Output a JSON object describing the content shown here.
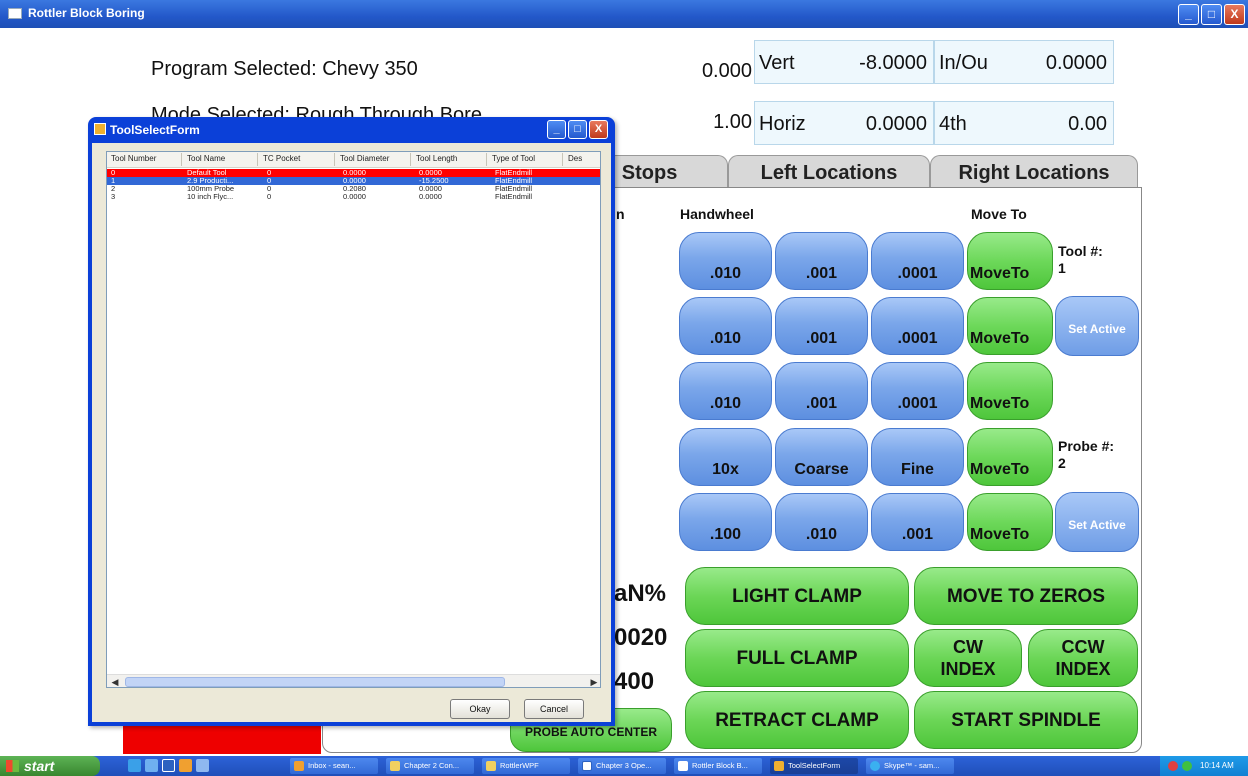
{
  "window": {
    "title": "Rottler Block Boring",
    "minimize": "_",
    "maximize": "□",
    "close": "X"
  },
  "header": {
    "program_label": "Program Selected: Chevy 350",
    "mode_label": "Mode Selected: Rough Through Bore",
    "readout_1": "0.000",
    "readout_2": "1.00",
    "vert_label": "Vert",
    "vert_value": "-8.0000",
    "inout_label": "In/Ou",
    "inout_value": "0.0000",
    "horiz_label": "Horiz",
    "horiz_value": "0.0000",
    "fourth_label": "4th",
    "fourth_value": "0.00"
  },
  "tabs": {
    "stops": "l Stops",
    "left": "Left Locations",
    "right": "Right Locations"
  },
  "panel": {
    "col_on": "n",
    "handwheel": "Handwheel",
    "move_to": "Move To",
    "row1": [
      ".010",
      ".001",
      ".0001"
    ],
    "row2": [
      ".010",
      ".001",
      ".0001"
    ],
    "row3": [
      ".010",
      ".001",
      ".0001"
    ],
    "row4": [
      "10x",
      "Coarse",
      "Fine"
    ],
    "row5": [
      ".100",
      ".010",
      ".001"
    ],
    "moveto_label": "MoveTo",
    "tool_label": "Tool #:",
    "tool_num": "1",
    "probe_label": "Probe #:",
    "probe_num": "2",
    "set_active": "Set Active",
    "partial_1": "aN%",
    "partial_2": "0020",
    "partial_3": "400",
    "light_clamp": "LIGHT CLAMP",
    "move_to_zeros": "MOVE TO ZEROS",
    "full_clamp": "FULL CLAMP",
    "cw_index": "CW\nINDEX",
    "ccw_index": "CCW\nINDEX",
    "retract_clamp": "RETRACT CLAMP",
    "start_spindle": "START SPINDLE",
    "probe_auto_center": "PROBE AUTO CENTER"
  },
  "dialog": {
    "title": "ToolSelectForm",
    "columns": [
      "Tool Number",
      "Tool Name",
      "TC Pocket",
      "Tool Diameter",
      "Tool Length",
      "Type of Tool",
      "Des"
    ],
    "rows": [
      [
        "0",
        "Default Tool",
        "0",
        "0.0000",
        "0.0000",
        "FlatEndmill"
      ],
      [
        "1",
        "2.9 Producti...",
        "0",
        "0.0000",
        "-15.2500",
        "FlatEndmill"
      ],
      [
        "2",
        "100mm Probe",
        "0",
        "0.2080",
        "0.0000",
        "FlatEndmill"
      ],
      [
        "3",
        "10 inch Flyc...",
        "0",
        "0.0000",
        "0.0000",
        "FlatEndmill"
      ]
    ],
    "okay": "Okay",
    "cancel": "Cancel"
  },
  "taskbar": {
    "start": "start",
    "tasks": [
      "Inbox - sean...",
      "Chapter 2 Con...",
      "RottlerWPF",
      "Chapter 3 Ope...",
      "Rottler Block B...",
      "ToolSelectForm",
      "Skype™ - sam..."
    ],
    "clock": "10:14 AM"
  },
  "colors": {
    "title_blue": "#2358c9",
    "button_blue": "#7aa6ea",
    "button_green": "#6dd85a",
    "selected_red": "#ff0000",
    "selected_blue": "#3168d6"
  }
}
